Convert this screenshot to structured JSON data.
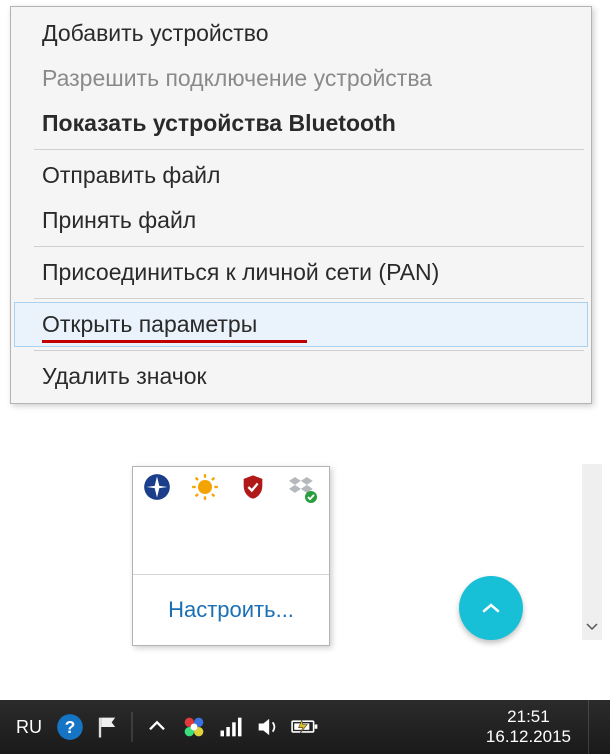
{
  "context_menu": {
    "items": [
      {
        "label": "Добавить устройство",
        "kind": "normal"
      },
      {
        "label": "Разрешить подключение устройства",
        "kind": "disabled"
      },
      {
        "label": "Показать устройства Bluetooth",
        "kind": "bold"
      },
      {
        "divider": true
      },
      {
        "label": "Отправить файл",
        "kind": "normal"
      },
      {
        "label": "Принять файл",
        "kind": "normal"
      },
      {
        "divider": true
      },
      {
        "label": "Присоединиться к личной сети (PAN)",
        "kind": "normal"
      },
      {
        "divider": true
      },
      {
        "label": "Открыть параметры",
        "kind": "hover"
      },
      {
        "divider": true
      },
      {
        "label": "Удалить значок",
        "kind": "normal"
      }
    ]
  },
  "tray_popup": {
    "icons": [
      "nav-icon",
      "sun-icon",
      "shield-icon",
      "dropbox-icon"
    ],
    "customise_label": "Настроить..."
  },
  "fab": {
    "icon": "chevron-up-icon"
  },
  "taskbar": {
    "language": "RU",
    "time": "21:51",
    "date": "16.12.2015",
    "icons": [
      "help-icon",
      "flag-icon",
      "tray-arrow-icon",
      "flower-icon",
      "signal-icon",
      "volume-icon",
      "battery-icon"
    ]
  }
}
